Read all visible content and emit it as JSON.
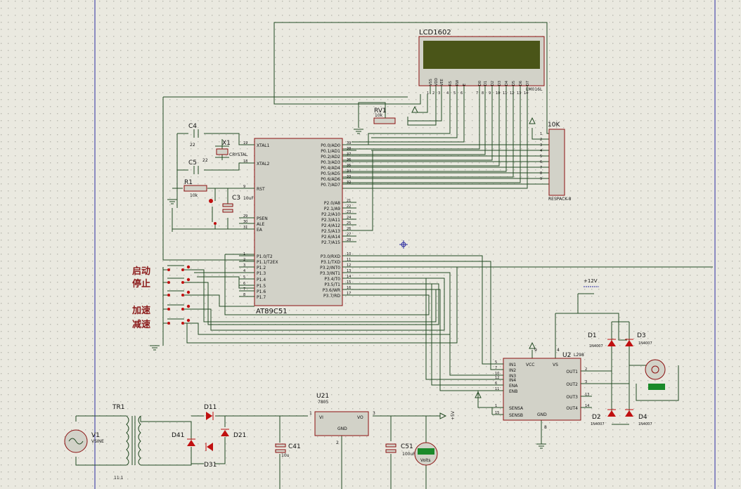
{
  "colors": {
    "background": "#eae9e0",
    "grid_dot": "#b9b8b0",
    "wire": "#234a23",
    "part_fill": "#d2d2c8",
    "part_border": "#8c1010",
    "lcd_screen": "#4a5518",
    "pin_red": "#c01010",
    "chinese_label": "#8b1a1a",
    "border_line": "#2a2aa0",
    "voltmeter_display": "#1a8a2a"
  },
  "lcd": {
    "name": "LCD1602",
    "model": "LM016L",
    "pins": [
      "VSS",
      "VDD",
      "VEE",
      "RS",
      "RW",
      "E",
      "D0",
      "D1",
      "D2",
      "D3",
      "D4",
      "D5",
      "D6",
      "D7"
    ],
    "pin_numbers": [
      "1",
      "2",
      "3",
      "4",
      "5",
      "6",
      "7",
      "8",
      "9",
      "10",
      "11",
      "12",
      "13",
      "14"
    ]
  },
  "mcu": {
    "name": "AT89C51",
    "left_pins": [
      {
        "label": "XTAL1",
        "num": "19"
      },
      {
        "label": "XTAL2",
        "num": "18"
      },
      {
        "label": "RST",
        "num": "9"
      },
      {
        "label": "PSEN",
        "num": "29"
      },
      {
        "label": "ALE",
        "num": "30"
      },
      {
        "label": "EA",
        "num": "31"
      },
      {
        "label": "P1.0/T2",
        "num": "1"
      },
      {
        "label": "P1.1/T2EX",
        "num": "2"
      },
      {
        "label": "P1.2",
        "num": "3"
      },
      {
        "label": "P1.3",
        "num": "4"
      },
      {
        "label": "P1.4",
        "num": "5"
      },
      {
        "label": "P1.5",
        "num": "6"
      },
      {
        "label": "P1.6",
        "num": "7"
      },
      {
        "label": "P1.7",
        "num": "8"
      }
    ],
    "right_pins": [
      {
        "label": "P0.0/AD0",
        "num": "39"
      },
      {
        "label": "P0.1/AD1",
        "num": "38"
      },
      {
        "label": "P0.2/AD2",
        "num": "37"
      },
      {
        "label": "P0.3/AD3",
        "num": "36"
      },
      {
        "label": "P0.4/AD4",
        "num": "35"
      },
      {
        "label": "P0.5/AD5",
        "num": "34"
      },
      {
        "label": "P0.6/AD6",
        "num": "33"
      },
      {
        "label": "P0.7/AD7",
        "num": "32"
      },
      {
        "label": "P2.0/A8",
        "num": "21"
      },
      {
        "label": "P2.1/A9",
        "num": "22"
      },
      {
        "label": "P2.2/A10",
        "num": "23"
      },
      {
        "label": "P2.3/A11",
        "num": "24"
      },
      {
        "label": "P2.4/A12",
        "num": "25"
      },
      {
        "label": "P2.5/A13",
        "num": "26"
      },
      {
        "label": "P2.6/A14",
        "num": "27"
      },
      {
        "label": "P2.7/A15",
        "num": "28"
      },
      {
        "label": "P3.0/RXD",
        "num": "10"
      },
      {
        "label": "P3.1/TXD",
        "num": "11"
      },
      {
        "label": "P3.2/INT0",
        "num": "12"
      },
      {
        "label": "P3.3/INT1",
        "num": "13"
      },
      {
        "label": "P3.4/T0",
        "num": "14"
      },
      {
        "label": "P3.5/T1",
        "num": "15"
      },
      {
        "label": "P3.6/WR",
        "num": "16"
      },
      {
        "label": "P3.7/RD",
        "num": "17"
      }
    ]
  },
  "components": {
    "c4": {
      "name": "C4",
      "value": "22"
    },
    "c5": {
      "name": "C5",
      "value": "22"
    },
    "x1": {
      "name": "X1",
      "value": "CRYSTAL"
    },
    "r1": {
      "name": "R1",
      "value": "10k"
    },
    "c3": {
      "name": "C3",
      "value": "10uF"
    },
    "rv1": {
      "name": "RV1",
      "value": "10k"
    },
    "rp": {
      "name": "10K",
      "model": "RESPACK-8",
      "pins": [
        "1",
        "2",
        "3",
        "4",
        "5",
        "6",
        "7",
        "8",
        "9"
      ]
    },
    "u2": {
      "name": "U2",
      "model": "L298",
      "left_pins": [
        {
          "label": "IN1",
          "num": "5"
        },
        {
          "label": "IN2",
          "num": "7"
        },
        {
          "label": "IN3",
          "num": "10"
        },
        {
          "label": "IN4",
          "num": "12"
        },
        {
          "label": "ENA",
          "num": "6"
        },
        {
          "label": "ENB",
          "num": "11"
        },
        {
          "label": "SENSA",
          "num": "1"
        },
        {
          "label": "SENSB",
          "num": "15"
        }
      ],
      "right_pins": [
        {
          "label": "OUT1",
          "num": "2"
        },
        {
          "label": "OUT2",
          "num": "3"
        },
        {
          "label": "OUT3",
          "num": "13"
        },
        {
          "label": "OUT4",
          "num": "14"
        }
      ],
      "vcc": "VCC",
      "vcc_num": "9",
      "vs": "VS",
      "vs_num": "4",
      "gnd": "GND",
      "gnd_num": "8"
    },
    "d1": {
      "name": "D1",
      "value": "1N4007"
    },
    "d2": {
      "name": "D2",
      "value": "1N4007"
    },
    "d3": {
      "name": "D3",
      "value": "1N4007"
    },
    "d4": {
      "name": "D4",
      "value": "1N4007"
    },
    "power_label": "+12V",
    "tr1": {
      "name": "TR1",
      "ratio": "11:1"
    },
    "v1": {
      "name": "V1",
      "model": "VSINE"
    },
    "d11": {
      "name": "D11"
    },
    "d21": {
      "name": "D21"
    },
    "d31": {
      "name": "D31"
    },
    "d41": {
      "name": "D41"
    },
    "c41": {
      "name": "C41",
      "value": "10u"
    },
    "c51": {
      "name": "C51",
      "value": "100uF"
    },
    "u21": {
      "name": "U21",
      "model": "7805",
      "vi": "VI",
      "vo": "VO",
      "gnd": "GND",
      "pin1": "1",
      "pin2": "2",
      "pin3": "3"
    },
    "rail_5v": "+5V",
    "voltmeter": {
      "unit": "Volts"
    }
  },
  "buttons": {
    "start": "启动",
    "stop": "停止",
    "speed_up": "加速",
    "speed_down": "减速"
  }
}
